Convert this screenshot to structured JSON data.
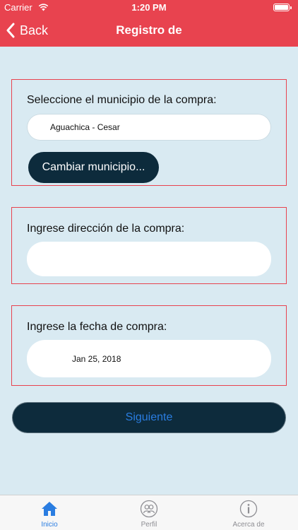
{
  "status_bar": {
    "carrier": "Carrier",
    "time": "1:20 PM"
  },
  "nav": {
    "back_label": "Back",
    "title": "Registro de"
  },
  "municipio": {
    "label": "Seleccione el municipio de la compra:",
    "value": "Aguachica - Cesar",
    "change_button": "Cambiar municipio..."
  },
  "direccion": {
    "label": "Ingrese dirección de la compra:",
    "value": ""
  },
  "fecha": {
    "label": "Ingrese la fecha de compra:",
    "value": "Jan 25, 2018"
  },
  "next_button": "Siguiente",
  "tabs": [
    {
      "label": "Inicio",
      "icon": "home-icon",
      "active": true
    },
    {
      "label": "Perfil",
      "icon": "profile-icon",
      "active": false
    },
    {
      "label": "Acerca de",
      "icon": "info-icon",
      "active": false
    }
  ],
  "colors": {
    "header": "#e8434f",
    "background": "#d9eaf2",
    "dark_button": "#0d2b3c",
    "link_blue": "#2a7de1"
  }
}
